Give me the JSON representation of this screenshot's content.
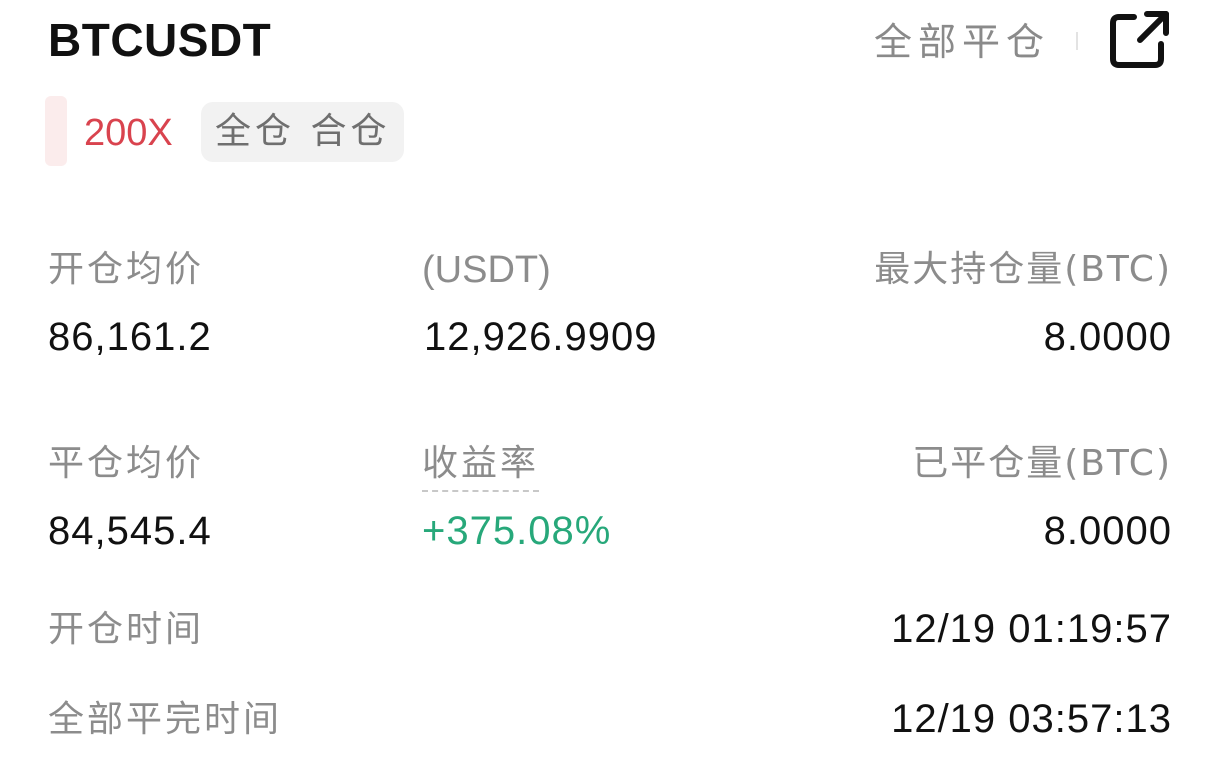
{
  "position": {
    "symbol": "BTCUSDT",
    "leverage": "200X",
    "margin_tag": "全仓 合仓",
    "close_all_label": "全部平仓"
  },
  "icons": {
    "share": "external-link-icon"
  },
  "fields": {
    "open_avg_label": "开仓均价",
    "open_avg_value": "86,161.2",
    "usdt_label": "(USDT)",
    "usdt_value": "12,926.9909",
    "max_hold_label": "最大持仓量(BTC)",
    "max_hold_value": "8.0000",
    "close_avg_label": "平仓均价",
    "close_avg_value": "84,545.4",
    "roi_label": "收益率",
    "roi_value": "+375.08%",
    "closed_qty_label": "已平仓量(BTC)",
    "closed_qty_value": "8.0000",
    "open_time_label": "开仓时间",
    "open_time_value": "12/19 01:19:57",
    "full_close_time_label": "全部平完时间",
    "full_close_time_value": "12/19 03:57:13"
  },
  "colors": {
    "loss": "#d9434e",
    "profit": "#27a87a",
    "label": "#8c8c8c",
    "text": "#111111"
  }
}
